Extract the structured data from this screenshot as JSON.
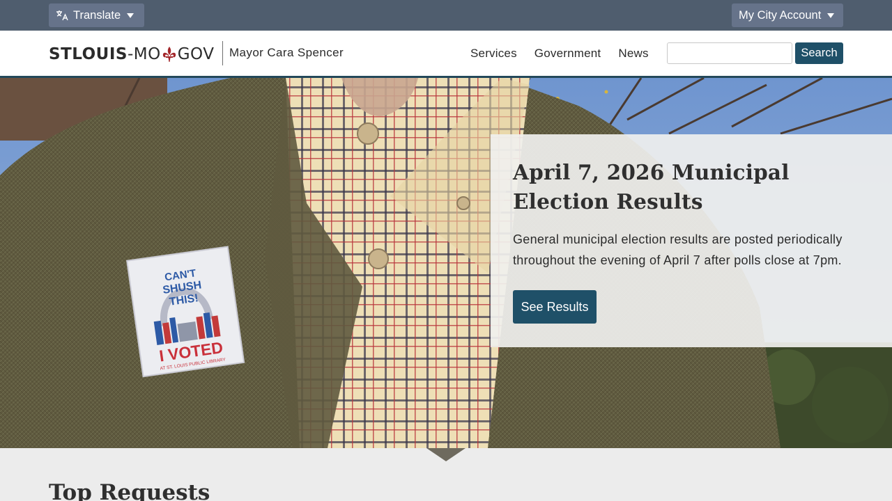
{
  "utility_bar": {
    "translate_label": "Translate",
    "account_label": "My City Account",
    "translate_icon": "translate-icon",
    "caret_icon": "caret-down-icon"
  },
  "header": {
    "logo": {
      "part1": "STLOUIS",
      "part2": "-MO",
      "part3": "GOV",
      "emblem": "fleur-de-lis-icon",
      "emblem_color": "#a3262a"
    },
    "mayor": "Mayor Cara Spencer",
    "nav": [
      "Services",
      "Government",
      "News"
    ],
    "search": {
      "value": "",
      "placeholder": "",
      "button_label": "Search"
    }
  },
  "hero": {
    "title": "April 7, 2026 Municipal Election Results",
    "description": "General municipal election results are posted periodically throughout the evening of April 7 after polls close at 7pm.",
    "button_label": "See Results",
    "sticker": {
      "line1": "CAN'T",
      "line2": "SHUSH",
      "line3": "THIS!",
      "voted": "I VOTED",
      "footer": "AT ST. LOUIS PUBLIC LIBRARY"
    }
  },
  "top_requests": {
    "title": "Top Requests"
  },
  "colors": {
    "utility_bar": "#4f5d6e",
    "primary_button": "#1f5068",
    "header_border": "#23485a",
    "section_bg": "#ececec"
  }
}
